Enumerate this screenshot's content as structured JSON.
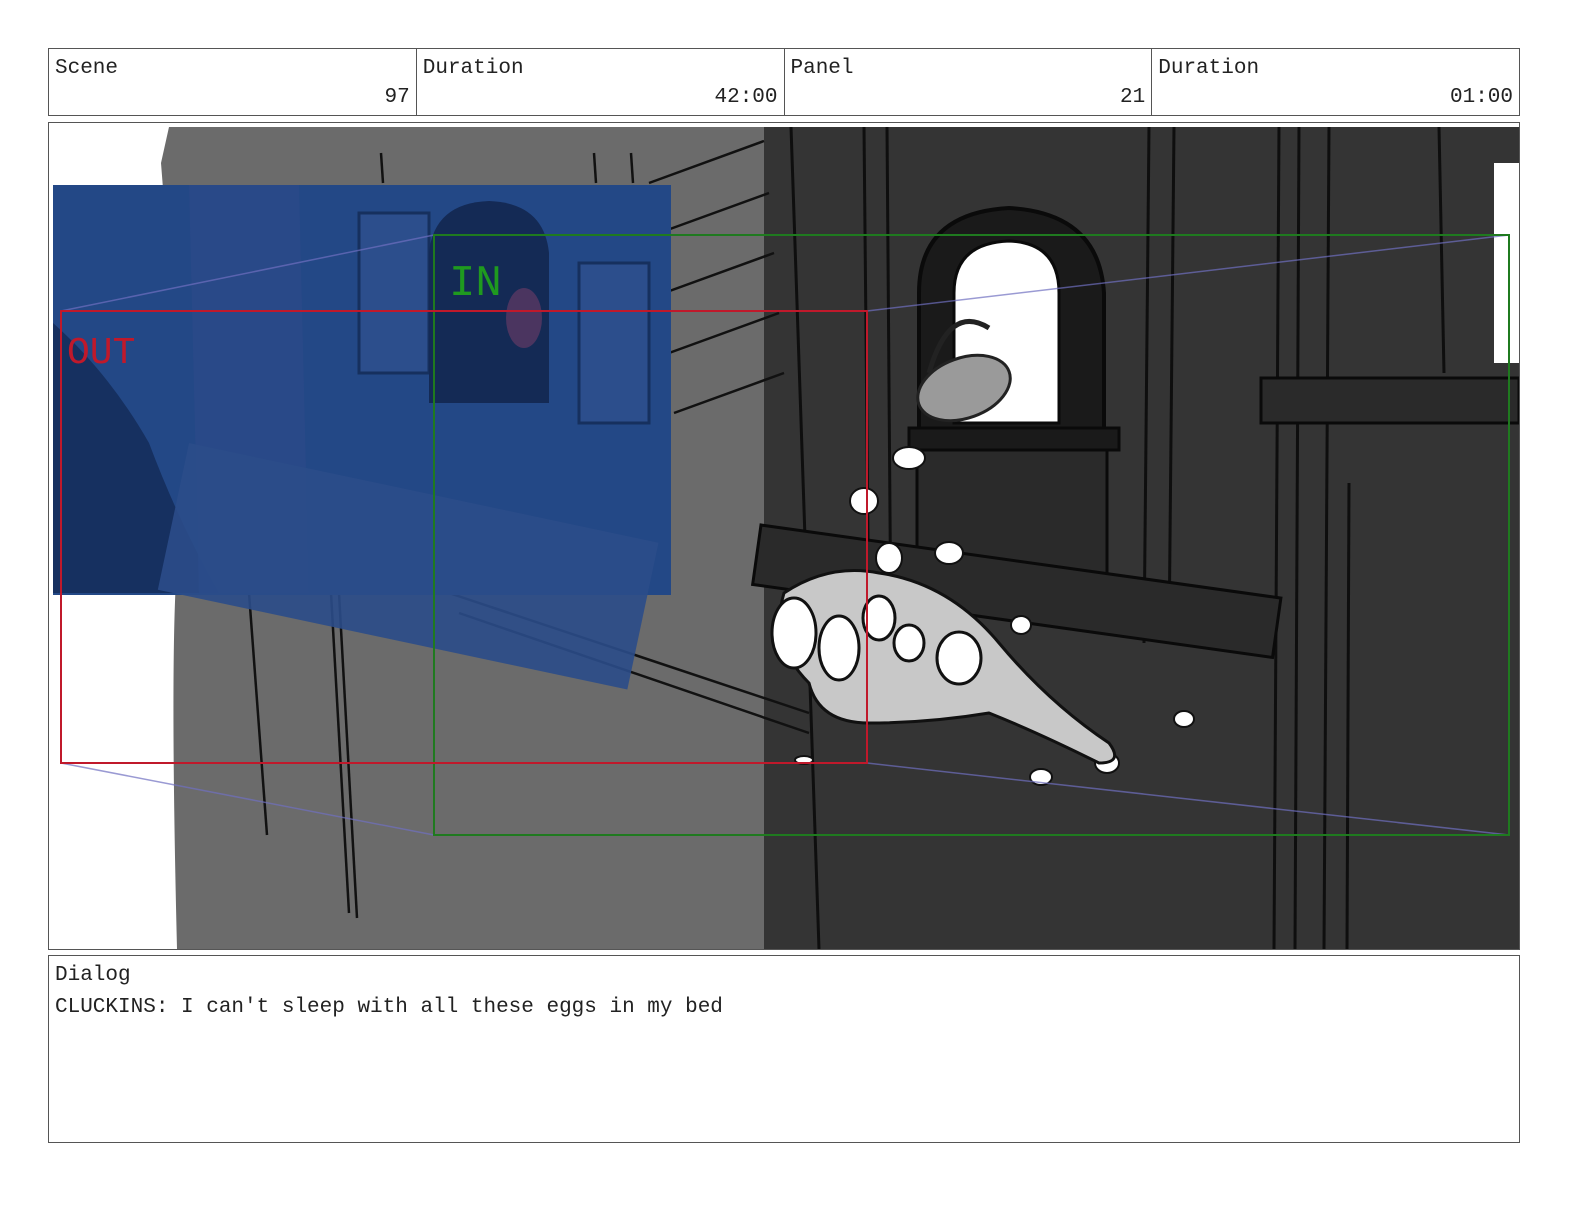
{
  "header": {
    "scene_label": "Scene",
    "scene_value": "97",
    "scene_duration_label": "Duration",
    "scene_duration_value": "42:00",
    "panel_label": "Panel",
    "panel_value": "21",
    "panel_duration_label": "Duration",
    "panel_duration_value": "01:00"
  },
  "frame": {
    "in_label": "IN",
    "out_label": "OUT",
    "in_color": "#1f7a1f",
    "out_color": "#c0192b",
    "motion_color": "#6f6fc0"
  },
  "dialog": {
    "label": "Dialog",
    "text": "CLUCKINS: I can't sleep with all these eggs in my bed"
  }
}
